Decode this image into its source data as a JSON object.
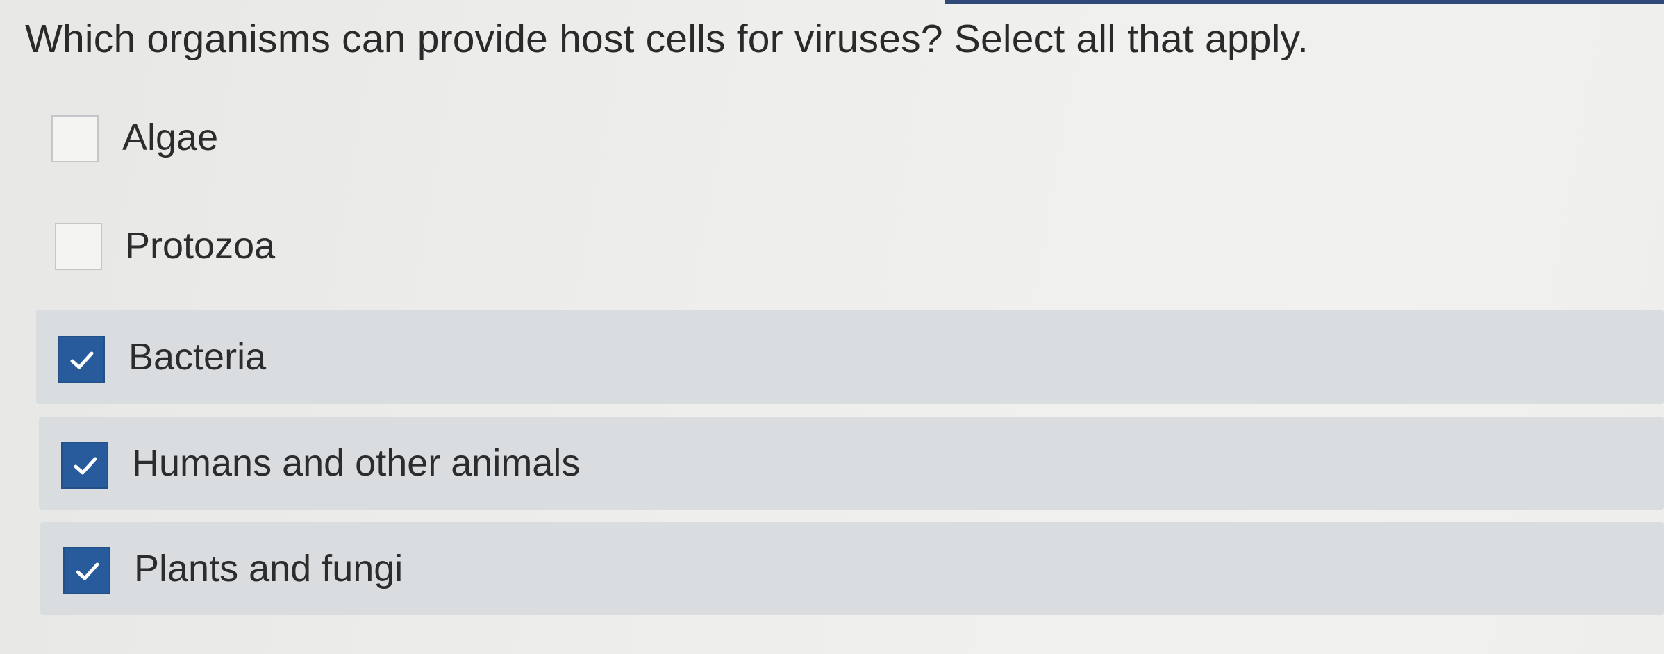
{
  "question": {
    "text": "Which organisms can provide host cells for viruses? Select all that apply."
  },
  "options": [
    {
      "label": "Algae",
      "checked": false
    },
    {
      "label": "Protozoa",
      "checked": false
    },
    {
      "label": "Bacteria",
      "checked": true
    },
    {
      "label": "Humans and other animals",
      "checked": true
    },
    {
      "label": "Plants and fungi",
      "checked": true
    }
  ],
  "colors": {
    "checkbox_checked": "#285b9c",
    "selected_row": "#d9dddf",
    "top_accent": "#2f4a78"
  },
  "icons": {
    "checked": "checkmark-icon"
  }
}
